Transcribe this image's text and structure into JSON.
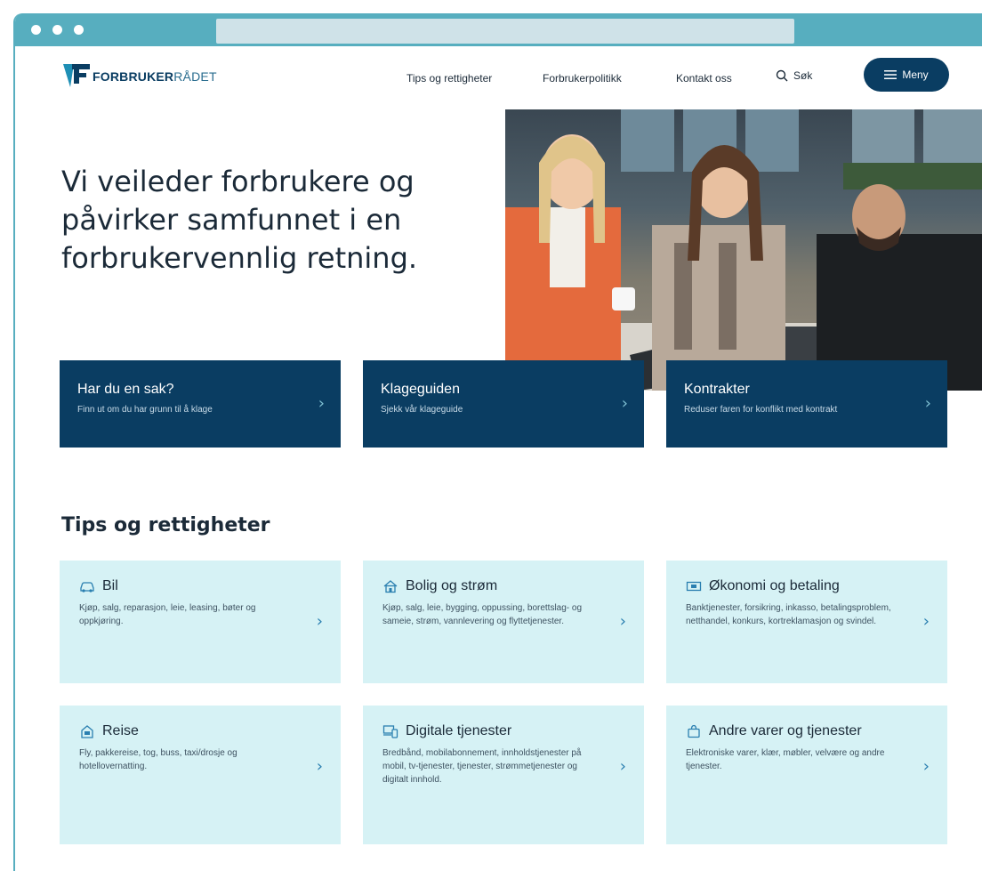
{
  "header": {
    "logo_bold": "FORBRUKER",
    "logo_light": "RÅDET",
    "nav": [
      "Tips og rettigheter",
      "Forbrukerpolitikk",
      "Kontakt oss"
    ],
    "search_label": "Søk",
    "menu_label": "Meny"
  },
  "hero": {
    "title": "Vi veileder forbrukere og påvirker samfunnet i en forbrukervennlig retning."
  },
  "quick_links": [
    {
      "title": "Har du en sak?",
      "subtitle": "Finn ut om du har grunn til å klage"
    },
    {
      "title": "Klageguiden",
      "subtitle": "Sjekk vår klageguide"
    },
    {
      "title": "Kontrakter",
      "subtitle": "Reduser faren for konflikt med kontrakt"
    }
  ],
  "section": {
    "title": "Tips og rettigheter",
    "cards": [
      {
        "icon": "car-icon",
        "title": "Bil",
        "desc": "Kjøp, salg, reparasjon, leie, leasing, bøter og oppkjøring."
      },
      {
        "icon": "house-icon",
        "title": "Bolig og strøm",
        "desc": "Kjøp, salg, leie, bygging, oppussing, borettslag- og sameie, strøm, vannlevering og flyttetjenester."
      },
      {
        "icon": "money-icon",
        "title": "Økonomi og betaling",
        "desc": "Banktjenester, forsikring, inkasso, betalingsproblem, netthandel, konkurs, kortreklamasjon og svindel."
      },
      {
        "icon": "travel-icon",
        "title": "Reise",
        "desc": "Fly, pakkereise, tog, buss, taxi/drosje og hotellovernatting."
      },
      {
        "icon": "devices-icon",
        "title": "Digitale tjenester",
        "desc": "Bredbånd, mobilabonnement, innholdstjenester på mobil, tv-tjenester, tjenester, strømmetjenester og digitalt innhold."
      },
      {
        "icon": "bag-icon",
        "title": "Andre varer og tjenester",
        "desc": "Elektroniske varer, klær, møbler, velvære og andre tjenester."
      }
    ]
  },
  "colors": {
    "navy": "#0a3d62",
    "chrome": "#57aebf",
    "card_bg": "#d6f2f5"
  }
}
